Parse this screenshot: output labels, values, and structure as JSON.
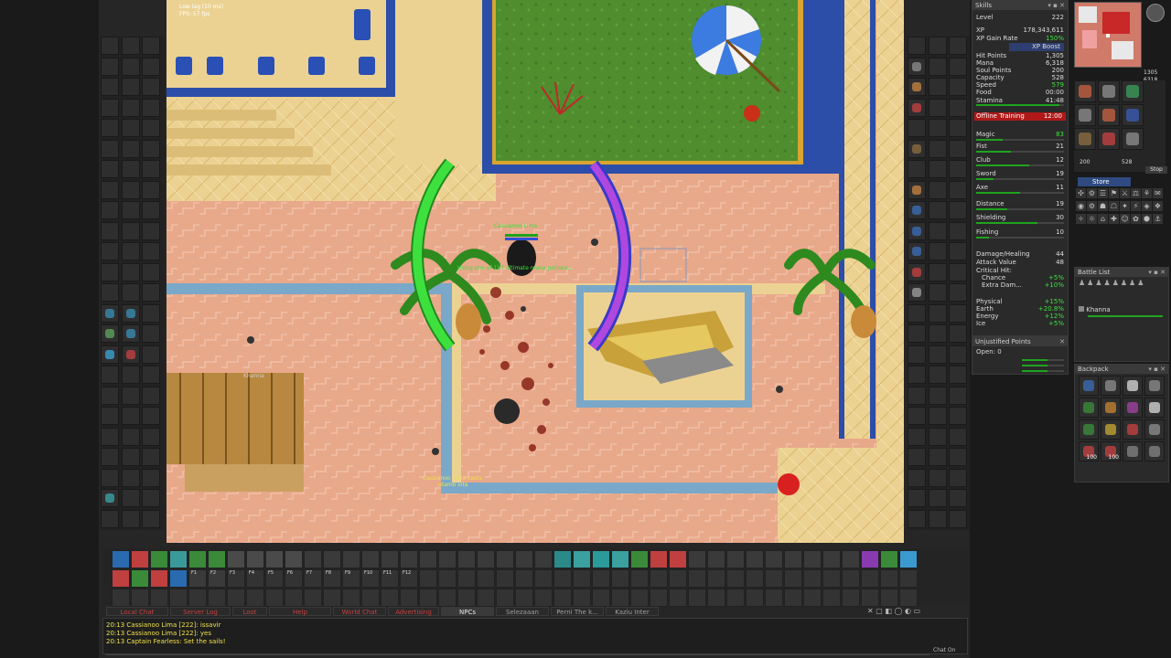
{
  "status": {
    "fps_line1": "Low lag (10 ms)",
    "fps_line2": "FPS: 57 fps"
  },
  "skills_panel": {
    "title": "Skills",
    "level_label": "Level",
    "level_value": "222",
    "xp_label": "XP",
    "xp_value": "178,343,611",
    "xp_gain_label": "XP Gain Rate",
    "xp_gain_value": "150%",
    "xp_boost_label": "XP Boost",
    "hp_label": "Hit Points",
    "hp_value": "1,305",
    "mana_label": "Mana",
    "mana_value": "6,318",
    "soul_label": "Soul Points",
    "soul_value": "200",
    "cap_label": "Capacity",
    "cap_value": "528",
    "speed_label": "Speed",
    "speed_value": "579",
    "food_label": "Food",
    "food_value": "00:00",
    "stamina_label": "Stamina",
    "stamina_value": "41:48",
    "offline_label": "Offline Training",
    "offline_value": "12:00",
    "magic_label": "Magic",
    "magic_value": "83",
    "fist_label": "Fist",
    "fist_value": "21",
    "club_label": "Club",
    "club_value": "12",
    "sword_label": "Sword",
    "sword_value": "19",
    "axe_label": "Axe",
    "axe_value": "11",
    "distance_label": "Distance",
    "distance_value": "19",
    "shielding_label": "Shielding",
    "shielding_value": "30",
    "fishing_label": "Fishing",
    "fishing_value": "10",
    "damage_label": "Damage/Healing",
    "damage_value": "44",
    "attack_label": "Attack Value",
    "attack_value": "48",
    "crit_label": "Critical Hit:",
    "chance_label": "Chance",
    "chance_value": "+5%",
    "extra_label": "Extra Dam...",
    "extra_value": "+10%",
    "physical_label": "Physical",
    "physical_value": "+15%",
    "earth_label": "Earth",
    "earth_value": "+20.8%",
    "energy_label": "Energy",
    "energy_value": "+12%",
    "ice_label": "Ice",
    "ice_value": "+5%"
  },
  "unjustified": {
    "title": "Unjustified Points",
    "open_label": "Open: 0"
  },
  "minimap": {
    "hp": "1305",
    "mana": "6318",
    "soul": "200",
    "cap": "528"
  },
  "store_button": "Store",
  "stop_button": "Stop",
  "battle_list": {
    "title": "Battle List",
    "entries": [
      "Khanna"
    ]
  },
  "backpack": {
    "title": "Backpack",
    "counts": [
      "100",
      "100"
    ]
  },
  "game": {
    "player_name": "Cassianoo Lima",
    "status_message": "Using one of 157 ultimate mana potions...",
    "cast_message_1": "Cassianoo Lima casts:",
    "cast_message_2": "utamo vita",
    "npc_name": "Khanna"
  },
  "chat_tabs": [
    "Local Chat",
    "Server Log",
    "Loot",
    "Help",
    "World Chat",
    "Advertising",
    "NPCs",
    "Selezaaan",
    "Perni The k...",
    "Kaziu Inter"
  ],
  "chat_lines": [
    "20:13 Cassianoo Lima [222]: issavir",
    "20:13 Cassianoo Lima [222]: yes",
    "20:13 Captain Fearless: Set the sails!"
  ],
  "chat_on_button": "Chat On",
  "hotkeys": [
    "F1",
    "F2",
    "F3",
    "F4",
    "F5",
    "F6",
    "F7",
    "F8",
    "F9",
    "F10",
    "F11",
    "F12"
  ],
  "colors": {
    "sand": "#e9cf8e",
    "floor": "#e7a98c",
    "grass": "#4e8a2e",
    "wall_blue": "#2d4ea8",
    "stamina_green": "#1fa31f",
    "offline_red": "#b01818"
  }
}
